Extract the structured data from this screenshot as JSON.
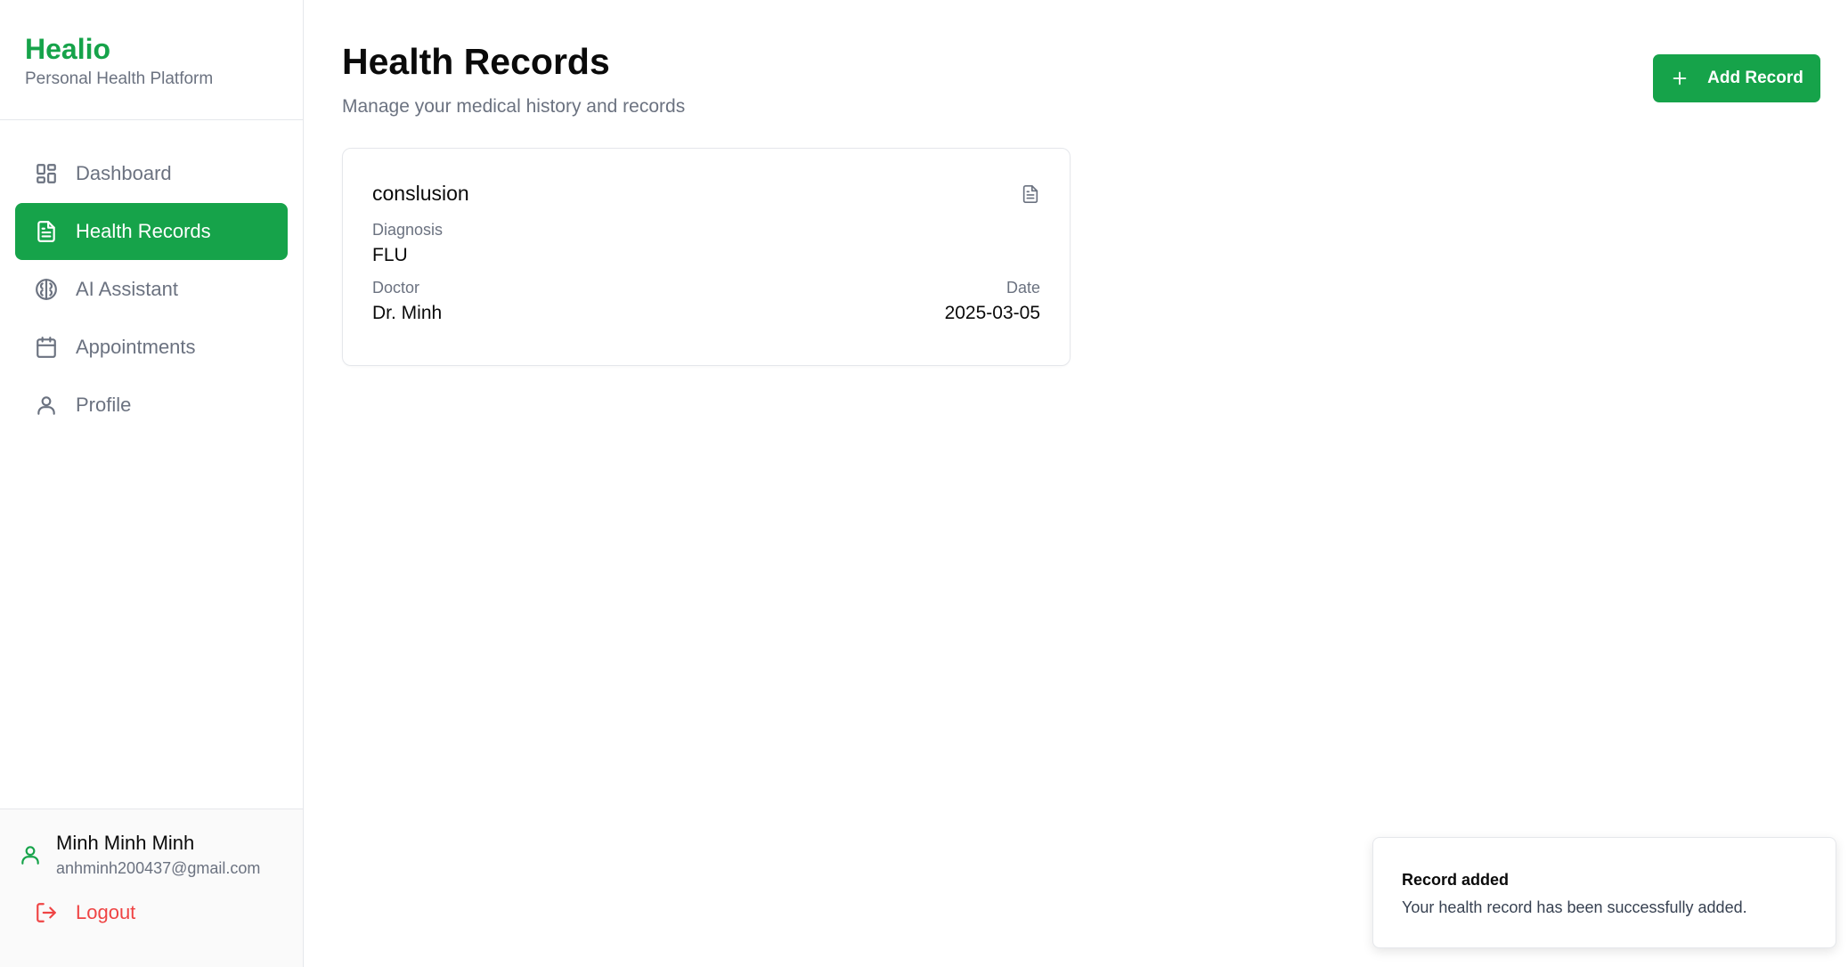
{
  "brand": {
    "name": "Healio",
    "tagline": "Personal Health Platform"
  },
  "nav": {
    "items": [
      {
        "label": "Dashboard",
        "icon": "dashboard-icon",
        "active": false
      },
      {
        "label": "Health Records",
        "icon": "file-text-icon",
        "active": true
      },
      {
        "label": "AI Assistant",
        "icon": "brain-icon",
        "active": false
      },
      {
        "label": "Appointments",
        "icon": "calendar-icon",
        "active": false
      },
      {
        "label": "Profile",
        "icon": "user-icon",
        "active": false
      }
    ]
  },
  "user": {
    "name": "Minh Minh Minh",
    "email": "anhminh200437@gmail.com",
    "logout_label": "Logout"
  },
  "header": {
    "title": "Health Records",
    "subtitle": "Manage your medical history and records",
    "add_button_label": "Add Record"
  },
  "records": [
    {
      "title": "conslusion",
      "diagnosis_label": "Diagnosis",
      "diagnosis": "FLU",
      "doctor_label": "Doctor",
      "doctor": "Dr. Minh",
      "date_label": "Date",
      "date": "2025-03-05"
    }
  ],
  "toast": {
    "title": "Record added",
    "message": "Your health record has been successfully added."
  },
  "colors": {
    "brand": "#16a34a",
    "danger": "#ef4444",
    "muted": "#6b7280",
    "border": "#e5e7eb"
  }
}
